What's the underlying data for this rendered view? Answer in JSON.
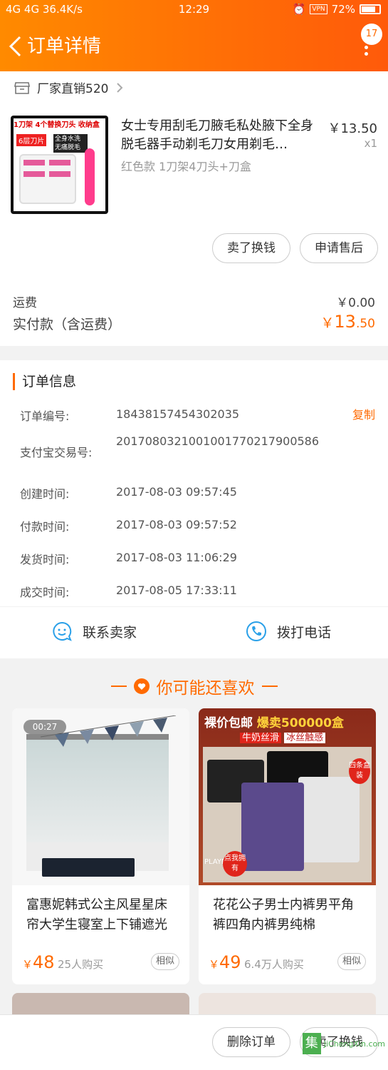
{
  "status_bar": {
    "left": "4G 4G 36.4K/s",
    "time": "12:29",
    "vpn": "VPN",
    "battery": "72%",
    "battery_level": 0.72
  },
  "header": {
    "title": "订单详情",
    "badge": "17"
  },
  "shop": {
    "name": "厂家直销520"
  },
  "product": {
    "title": "女士专用刮毛刀腋毛私处腋下全身脱毛器手动剃毛刀女用剃毛…",
    "price": "￥13.50",
    "qty": "x1",
    "sku": "红色款 1刀架4刀头+刀盒",
    "img_text": {
      "a": "1刀架",
      "b": "4个替换刀头",
      "c": "收纳盒",
      "d": "6层刀片",
      "e": "全身水洗",
      "f": "无痛脱毛"
    }
  },
  "product_buttons": {
    "sell": "卖了换钱",
    "after_sale": "申请售后"
  },
  "fees": {
    "shipping_label": "运费",
    "shipping_value": "￥0.00",
    "paid_label": "实付款（含运费）",
    "paid_symbol": "￥",
    "paid_int": "13",
    "paid_dec": ".50"
  },
  "order_info": {
    "title": "订单信息",
    "copy": "复制",
    "rows": [
      {
        "label": "订单编号:",
        "value": "18438157454302035"
      },
      {
        "label": "支付宝交易号:",
        "value": "2017080321001001770217900586"
      },
      {
        "label": "创建时间:",
        "value": "2017-08-03 09:57:45"
      },
      {
        "label": "付款时间:",
        "value": "2017-08-03 09:57:52"
      },
      {
        "label": "发货时间:",
        "value": "2017-08-03 11:06:29"
      },
      {
        "label": "成交时间:",
        "value": "2017-08-05 17:33:11"
      }
    ]
  },
  "contact": {
    "seller": "联系卖家",
    "phone": "拨打电话"
  },
  "recommend": {
    "title": "你可能还喜欢",
    "items": [
      {
        "title": "富惠妮韩式公主风星星床帘大学生寝室上下铺遮光",
        "symbol": "￥",
        "price": "48",
        "sold": "25人购买",
        "similar": "相似",
        "video": "00:27"
      },
      {
        "title": "花花公子男士内裤男平角裤四角内裤男纯棉",
        "symbol": "￥",
        "price": "49",
        "sold": "6.4万人购买",
        "similar": "相似",
        "banner1": "裸价包邮",
        "banner2": "爆卖500000盒",
        "banner3": "牛奶丝滑",
        "banner4": "冰丝触感",
        "brand": "PLAYBOY",
        "tag1": "四条盒装",
        "tag2": "点我拥有"
      }
    ]
  },
  "bottom_bar": {
    "delete": "删除订单",
    "sell": "卖了换钱"
  },
  "watermark": {
    "glyph": "集",
    "text": "JiChengXin.com"
  },
  "colors": {
    "accent": "#ff6a00",
    "header_start": "#ff8a00",
    "header_end": "#ff5a0a",
    "contact_icon": "#2aa0e8"
  }
}
